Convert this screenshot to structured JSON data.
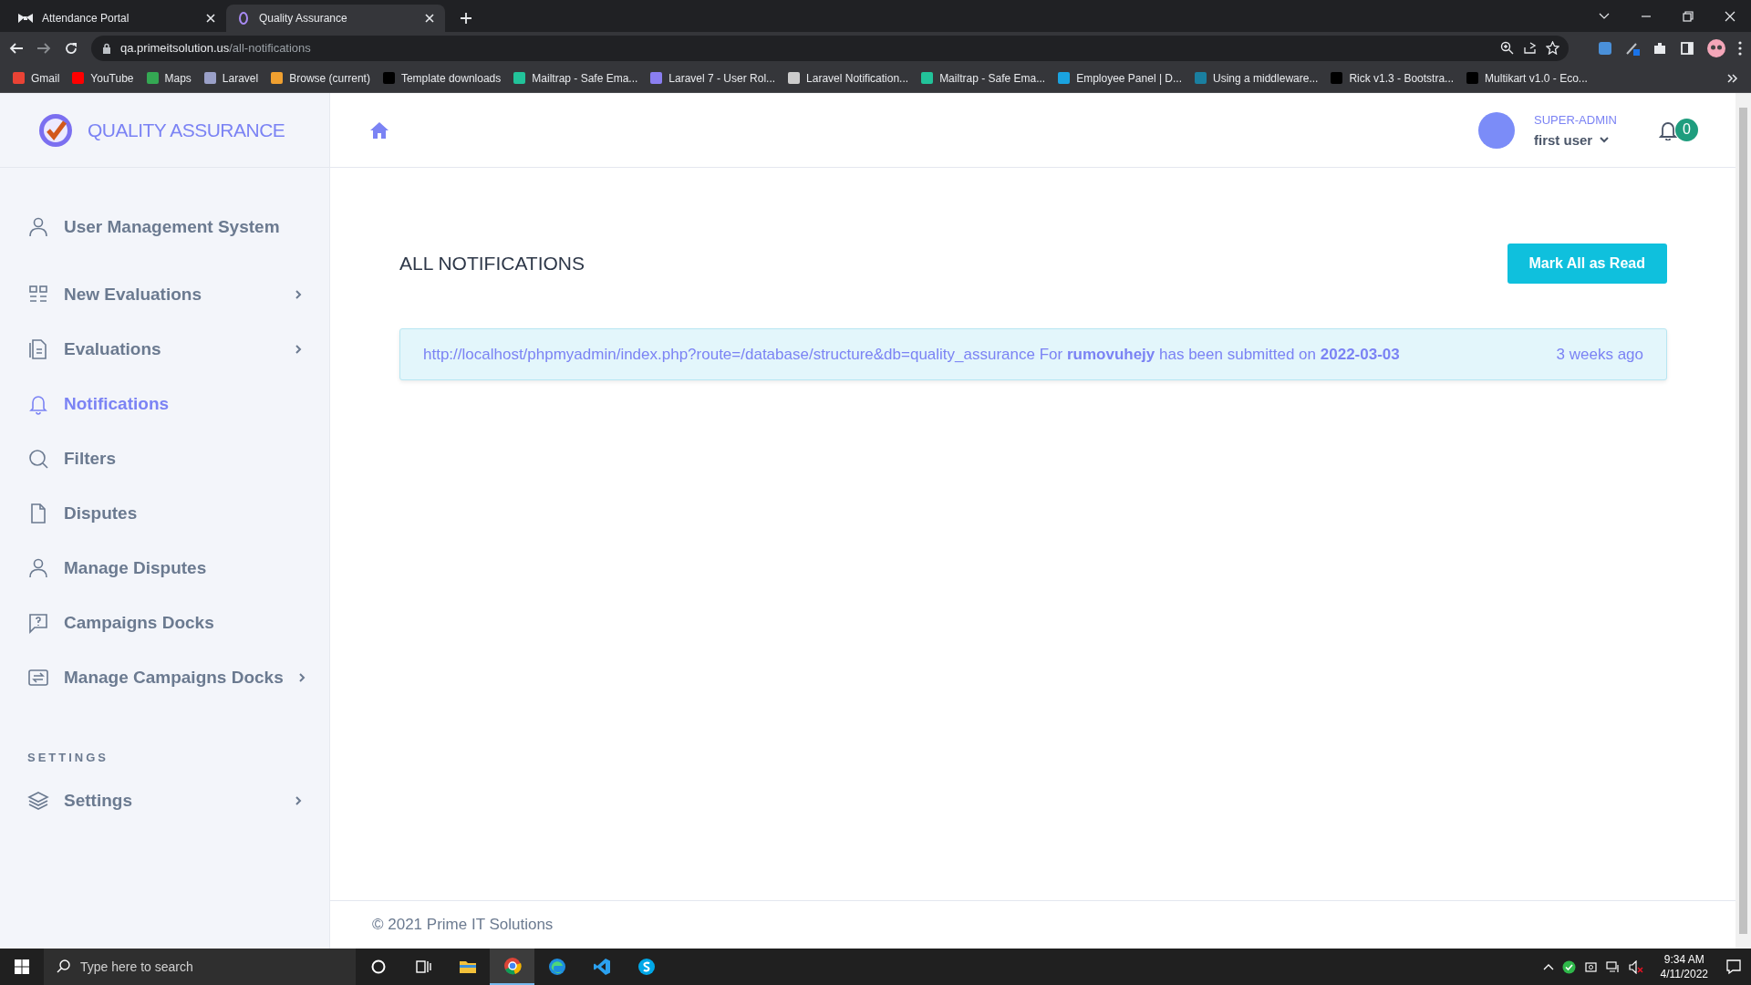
{
  "browser": {
    "tabs": [
      {
        "title": "Attendance Portal",
        "selected": false
      },
      {
        "title": "Quality Assurance",
        "selected": true
      }
    ],
    "address": {
      "host": "qa.primeitsolution.us",
      "path": "/all-notifications"
    },
    "bookmarks": [
      {
        "label": "Gmail",
        "color": "#ea4335"
      },
      {
        "label": "YouTube",
        "color": "#ff0000"
      },
      {
        "label": "Maps",
        "color": "#34a853"
      },
      {
        "label": "Laravel",
        "color": "#9aa0c8"
      },
      {
        "label": "Browse (current)",
        "color": "#f0a030"
      },
      {
        "label": "Template downloads",
        "color": "#000000"
      },
      {
        "label": "Mailtrap - Safe Ema...",
        "color": "#22c39a"
      },
      {
        "label": "Laravel 7 - User Rol...",
        "color": "#8a7ef0"
      },
      {
        "label": "Laravel Notification...",
        "color": "#cccccc"
      },
      {
        "label": "Mailtrap - Safe Ema...",
        "color": "#22c39a"
      },
      {
        "label": "Employee Panel | D...",
        "color": "#1aa3e0"
      },
      {
        "label": "Using a middleware...",
        "color": "#1a7fa0"
      },
      {
        "label": "Rick v1.3 - Bootstra...",
        "color": "#000000"
      },
      {
        "label": "Multikart v1.0 - Eco...",
        "color": "#000000"
      }
    ]
  },
  "app": {
    "logo_text": "QUALITY ASSURANCE",
    "sidebar": {
      "items": [
        {
          "kind": "user",
          "label": "User Management System",
          "selected": false,
          "expandable": false
        },
        {
          "kind": "grid",
          "label": "New Evaluations",
          "selected": false,
          "expandable": true
        },
        {
          "kind": "document",
          "label": "Evaluations",
          "selected": false,
          "expandable": true
        },
        {
          "kind": "bell",
          "label": "Notifications",
          "selected": true,
          "expandable": false
        },
        {
          "kind": "search",
          "label": "Filters",
          "selected": false,
          "expandable": false
        },
        {
          "kind": "file",
          "label": "Disputes",
          "selected": false,
          "expandable": false
        },
        {
          "kind": "user",
          "label": "Manage Disputes",
          "selected": false,
          "expandable": false
        },
        {
          "kind": "question",
          "label": "Campaigns Docks",
          "selected": false,
          "expandable": false
        },
        {
          "kind": "transfer",
          "label": "Manage Campaigns Docks",
          "selected": false,
          "expandable": true
        }
      ],
      "section_title": "SETTINGS",
      "settings_items": [
        {
          "kind": "layers",
          "label": "Settings",
          "selected": false,
          "expandable": true
        }
      ]
    },
    "header": {
      "role": "SUPER-ADMIN",
      "user": "first user",
      "notification_count": "0"
    },
    "page_title": "ALL NOTIFICATIONS",
    "mark_all_button": "Mark All as Read",
    "notifications": [
      {
        "text": "http://localhost/phpmyadmin/index.php?route=/database/structure&db=quality_assurance For **rumovuhejy** has been submitted on **2022-03-03**",
        "time": "3 weeks ago"
      }
    ],
    "footer": "© 2021 Prime IT Solutions"
  },
  "taskbar": {
    "search_placeholder": "Type here to search",
    "apps": [
      {
        "kind": "cortana",
        "selected": false
      },
      {
        "kind": "taskview",
        "selected": false
      },
      {
        "kind": "explorer",
        "selected": false
      },
      {
        "kind": "chrome",
        "selected": true
      },
      {
        "kind": "edge",
        "selected": false
      },
      {
        "kind": "vscode",
        "selected": false
      },
      {
        "kind": "skype",
        "selected": false
      }
    ],
    "time": "9:34 AM",
    "date": "4/11/2022"
  }
}
